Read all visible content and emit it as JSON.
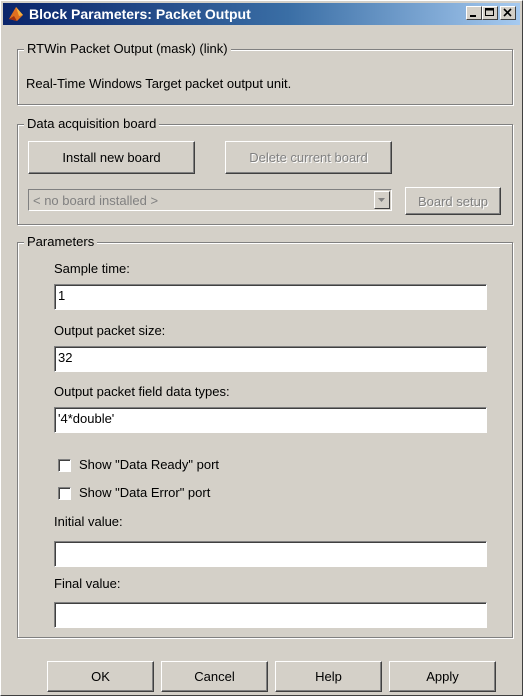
{
  "window": {
    "title": "Block Parameters: Packet Output"
  },
  "mask": {
    "header": "RTWin Packet Output (mask) (link)",
    "description": "Real-Time Windows Target packet output unit."
  },
  "board": {
    "legend": "Data acquisition board",
    "install_label": "Install new board",
    "delete_label": "Delete current board",
    "selected_board": "< no board installed >",
    "setup_label": "Board setup"
  },
  "params": {
    "legend": "Parameters",
    "sample_time_label": "Sample time:",
    "sample_time_value": "1",
    "packet_size_label": "Output packet size:",
    "packet_size_value": "32",
    "data_types_label": "Output packet field data types:",
    "data_types_value": "'4*double'",
    "show_ready_label": "Show \"Data Ready\" port",
    "show_error_label": "Show \"Data Error\" port",
    "initial_value_label": "Initial value:",
    "initial_value": "",
    "final_value_label": "Final value:",
    "final_value": ""
  },
  "buttons": {
    "ok": "OK",
    "cancel": "Cancel",
    "help": "Help",
    "apply": "Apply"
  }
}
